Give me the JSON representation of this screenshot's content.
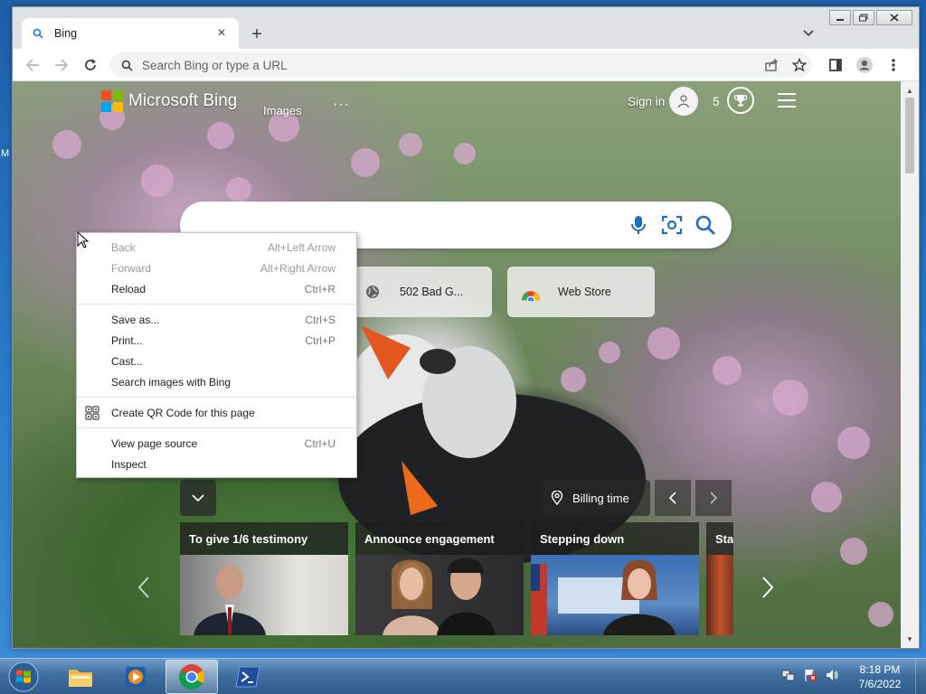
{
  "desktop": {
    "edge_text": "M"
  },
  "browser": {
    "tab": {
      "title": "Bing",
      "close": "×"
    },
    "new_tab": "+",
    "omnibox": {
      "placeholder": "Search Bing or type a URL"
    },
    "window_controls": [
      "minimize",
      "maximize",
      "close"
    ]
  },
  "bing": {
    "brand": "Microsoft Bing",
    "nav": {
      "images": "Images",
      "more": "···"
    },
    "sign_in": "Sign in",
    "points": "5",
    "tiles": [
      {
        "label": "502 Bad G...",
        "icon": "globe-icon"
      },
      {
        "label": "Web Store",
        "icon": "chrome-icon"
      }
    ],
    "location": "Billing time",
    "news": [
      {
        "title": "To give 1/6 testimony"
      },
      {
        "title": "Announce engagement"
      },
      {
        "title": "Stepping down"
      },
      {
        "title": "Star"
      }
    ],
    "colors": {
      "ms_red": "#f25022",
      "ms_green": "#7fba00",
      "ms_blue": "#00a4ef",
      "ms_yellow": "#ffb900"
    }
  },
  "context_menu": {
    "items": [
      {
        "label": "Back",
        "shortcut": "Alt+Left Arrow",
        "disabled": true
      },
      {
        "label": "Forward",
        "shortcut": "Alt+Right Arrow",
        "disabled": true
      },
      {
        "label": "Reload",
        "shortcut": "Ctrl+R",
        "disabled": false
      },
      {
        "label": "Save as...",
        "shortcut": "Ctrl+S",
        "disabled": false
      },
      {
        "label": "Print...",
        "shortcut": "Ctrl+P",
        "disabled": false
      },
      {
        "label": "Cast...",
        "shortcut": "",
        "disabled": false
      },
      {
        "label": "Search images with Bing",
        "shortcut": "",
        "disabled": false
      },
      {
        "label": "Create QR Code for this page",
        "shortcut": "",
        "disabled": false
      },
      {
        "label": "View page source",
        "shortcut": "Ctrl+U",
        "disabled": false
      },
      {
        "label": "Inspect",
        "shortcut": "",
        "disabled": false
      }
    ]
  },
  "taskbar": {
    "clock": {
      "time": "8:18 PM",
      "date": "7/6/2022"
    },
    "pinned": [
      "file-explorer",
      "media-player",
      "chrome",
      "powershell"
    ]
  }
}
